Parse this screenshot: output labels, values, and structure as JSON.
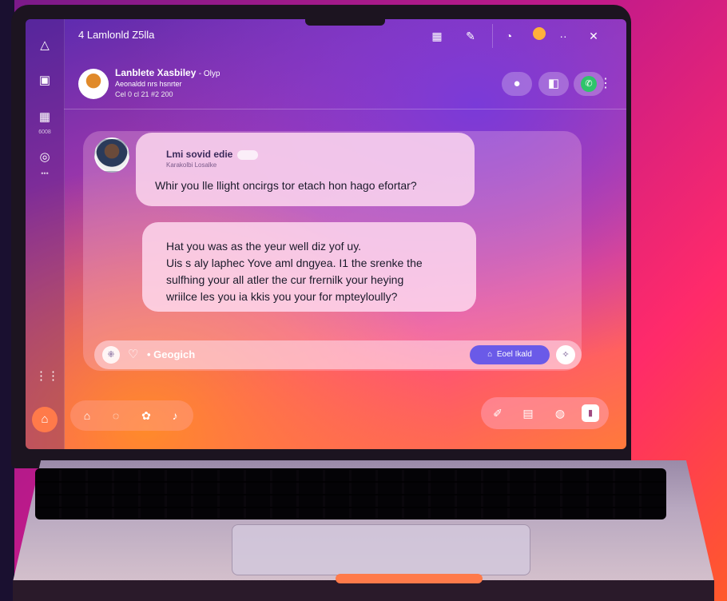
{
  "window": {
    "title": "4 Lamlonld Z5lla"
  },
  "rail": {
    "label_tag": "6008",
    "dots": "•••"
  },
  "topbar": {
    "icons": [
      "grid-icon",
      "edit-icon",
      "clock-icon",
      "avatar-icon"
    ],
    "more": "··",
    "close": "✕"
  },
  "contact": {
    "name": "Lanblete Xasbiley",
    "name_suffix": "- Olyp",
    "status": "Aeonaldd nrs hsnrter",
    "time": "Cel 0 cl 21 #2 200"
  },
  "messages": [
    {
      "sender": "Lmi sovid edie",
      "sender_sub": "Karakolbi Losalke",
      "text": "Whir you lle llight oncirgs tor etach hon hago efortar?"
    },
    {
      "lines": [
        "Hat you was as the yeur well diz yof uy.",
        "Uis s aly laphec Yove aml dngyea. I1 the srenke the",
        "sulfhing your all atler the cur frernilk your heying",
        "wriilce les you ia kkis you your for mpteyloully?"
      ]
    }
  ],
  "composer": {
    "placeholder": "• Geogich",
    "send_label": "Eoel Ikald"
  },
  "colors": {
    "send_button": "#6a5ae8",
    "online": "#2fc46a",
    "home": "#ff7a4a"
  }
}
